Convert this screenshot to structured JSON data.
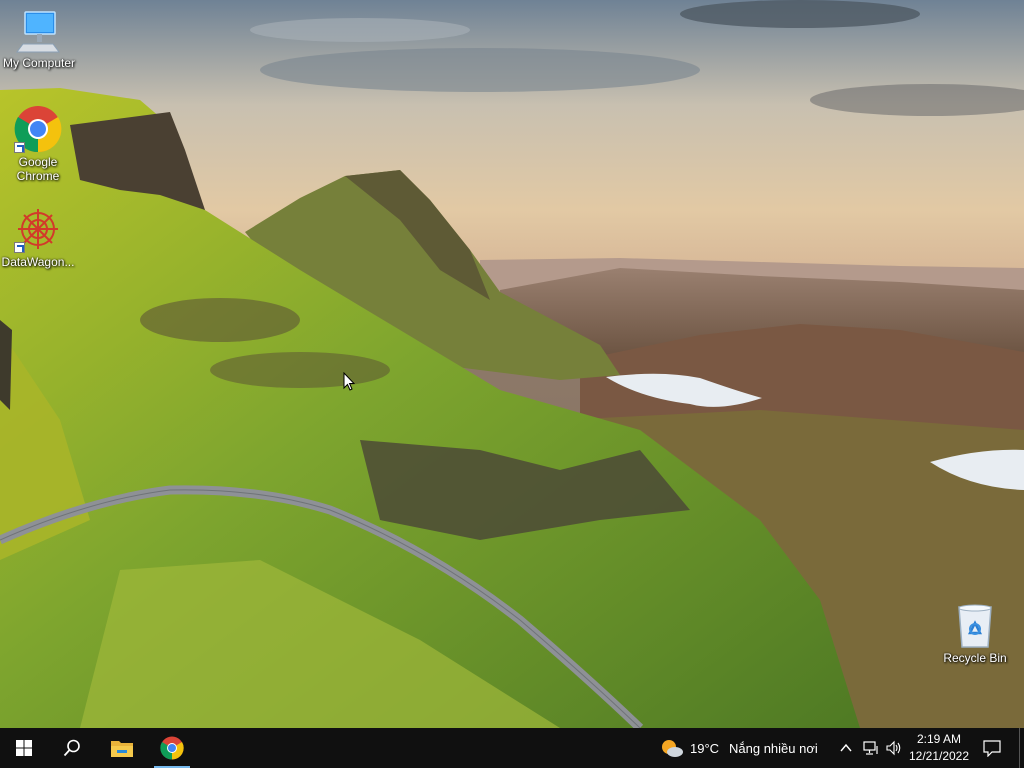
{
  "desktop": {
    "icons": [
      {
        "id": "my-computer",
        "label": "My Computer"
      },
      {
        "id": "google-chrome",
        "label": "Google Chrome"
      },
      {
        "id": "datawagon",
        "label": "DataWagon..."
      },
      {
        "id": "recycle-bin",
        "label": "Recycle Bin"
      }
    ]
  },
  "taskbar": {
    "weather": {
      "temperature": "19°C",
      "description": "Nắng nhiều nơi"
    },
    "clock": {
      "time": "2:19 AM",
      "date": "12/21/2022"
    },
    "pinned": [
      "start-icon",
      "search-icon",
      "file-explorer-icon",
      "chrome-icon"
    ],
    "tray": [
      "chevron-up-icon",
      "network-icon",
      "volume-icon",
      "notification-icon"
    ]
  },
  "colors": {
    "taskbar": "#101010",
    "chrome_red": "#db4437",
    "chrome_yellow": "#f4c20d",
    "chrome_green": "#0f9d58",
    "chrome_blue": "#4285f4"
  }
}
